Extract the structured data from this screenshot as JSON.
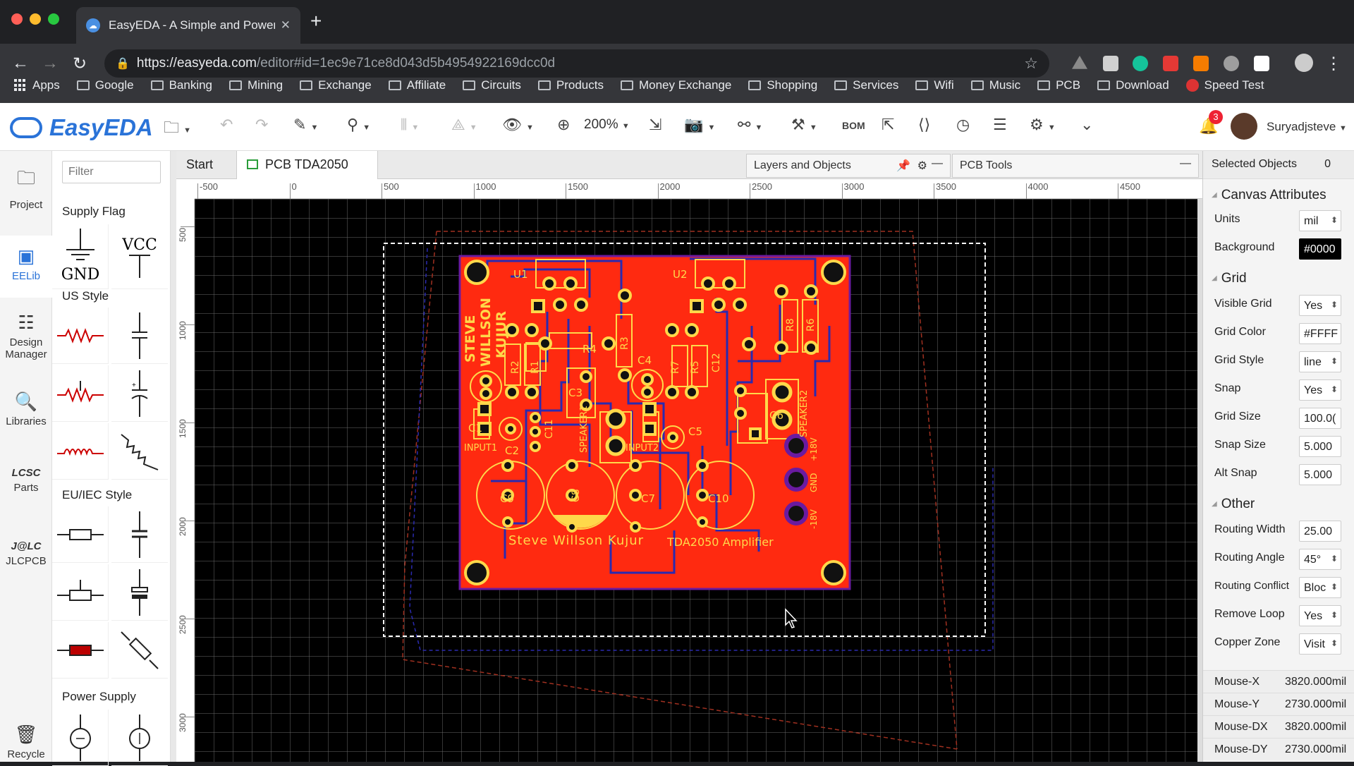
{
  "browser": {
    "tab_title": "EasyEDA - A Simple and Powerf",
    "url_host": "https://easyeda.com",
    "url_path": "/editor#id=1ec9e71ce8d043d5b4954922169dcc0d",
    "bookmarks": [
      "Apps",
      "Google",
      "Banking",
      "Mining",
      "Exchange",
      "Affiliate",
      "Circuits",
      "Products",
      "Money Exchange",
      "Shopping",
      "Services",
      "Wifi",
      "Music",
      "PCB",
      "Download",
      "Speed Test"
    ]
  },
  "app": {
    "logo": "EasyEDA",
    "zoom": "200%",
    "bom": "BOM",
    "notifications": "3",
    "user": "Suryadjsteve"
  },
  "rail": [
    {
      "label": "Project",
      "icon": "folder-icon"
    },
    {
      "label": "EELib",
      "icon": "chip-icon"
    },
    {
      "label": "Design\nManager",
      "icon": "list-icon"
    },
    {
      "label": "Libraries",
      "icon": "search-icon"
    },
    {
      "label": "Parts",
      "icon": "lcsc-icon"
    },
    {
      "label": "JLCPCB",
      "icon": "jlc-icon"
    },
    {
      "label": "Recycle",
      "icon": "trash-icon"
    }
  ],
  "library": {
    "filter_placeholder": "Filter",
    "sections": [
      "Supply Flag",
      "US Style",
      "EU/IEC Style",
      "Power Supply"
    ],
    "gnd": "GND",
    "vcc": "VCC"
  },
  "tabs": {
    "start": "Start",
    "pcb": "PCB TDA2050",
    "layers": "Layers and Objects",
    "pcbtools": "PCB Tools"
  },
  "rulers": {
    "h": [
      "-500",
      "0",
      "500",
      "1000",
      "1500",
      "2000",
      "2500",
      "3000",
      "3500",
      "4000",
      "4500"
    ],
    "v": [
      "500",
      "1000",
      "1500",
      "2000",
      "2500",
      "3000"
    ]
  },
  "pcb": {
    "silk": {
      "u1": "U1",
      "u2": "U2",
      "r1": "R1",
      "r2": "R2",
      "r3": "R3",
      "r4": "R4",
      "r5": "R5",
      "r6": "R6",
      "r7": "R7",
      "r8": "R8",
      "c1": "C1",
      "c2": "C2",
      "c3": "C3",
      "c4": "C4",
      "c5": "C5",
      "c6": "C6",
      "c7": "C7",
      "c8": "C8",
      "c9": "C9",
      "c10": "C10",
      "c11": "C11",
      "c12": "C12",
      "input1": "INPUT1",
      "input2": "INPUT2",
      "speaker1": "SPEAKER1",
      "speaker2": "SPEAKER2",
      "p18": "+18V",
      "gnd": "GND",
      "m18": "-18V",
      "steve": "STEVE",
      "willson": "WILLSON",
      "kujur": "KUJUR",
      "author": "Steve Willson Kujur",
      "title": "TDA2050 Amplifier"
    }
  },
  "right": {
    "selected_label": "Selected Objects",
    "selected_count": "0",
    "canvas_attributes": "Canvas Attributes",
    "units_label": "Units",
    "units": "mil",
    "background_label": "Background",
    "background": "#0000",
    "grid_section": "Grid",
    "visible_grid_label": "Visible Grid",
    "visible_grid": "Yes",
    "grid_color_label": "Grid Color",
    "grid_color": "#FFFF",
    "grid_style_label": "Grid Style",
    "grid_style": "line",
    "snap_label": "Snap",
    "snap": "Yes",
    "grid_size_label": "Grid Size",
    "grid_size": "100.0(",
    "snap_size_label": "Snap Size",
    "snap_size": "5.000",
    "alt_snap_label": "Alt Snap",
    "alt_snap": "5.000",
    "other_section": "Other",
    "routing_width_label": "Routing Width",
    "routing_width": "25.00",
    "routing_angle_label": "Routing Angle",
    "routing_angle": "45°",
    "routing_conflict_label": "Routing Conflict",
    "routing_conflict": "Bloc",
    "remove_loop_label": "Remove Loop",
    "remove_loop": "Yes",
    "copper_zone_label": "Copper Zone",
    "copper_zone": "Visit",
    "mouse_x_label": "Mouse-X",
    "mouse_x": "3820.000mil",
    "mouse_y_label": "Mouse-Y",
    "mouse_y": "2730.000mil",
    "mouse_dx_label": "Mouse-DX",
    "mouse_dx": "3820.000mil",
    "mouse_dy_label": "Mouse-DY",
    "mouse_dy": "2730.000mil"
  },
  "colors": {
    "board": "#ff2a10",
    "silk": "#ffd84a",
    "track": "#2a2ab0",
    "accent": "#2a73d8"
  }
}
